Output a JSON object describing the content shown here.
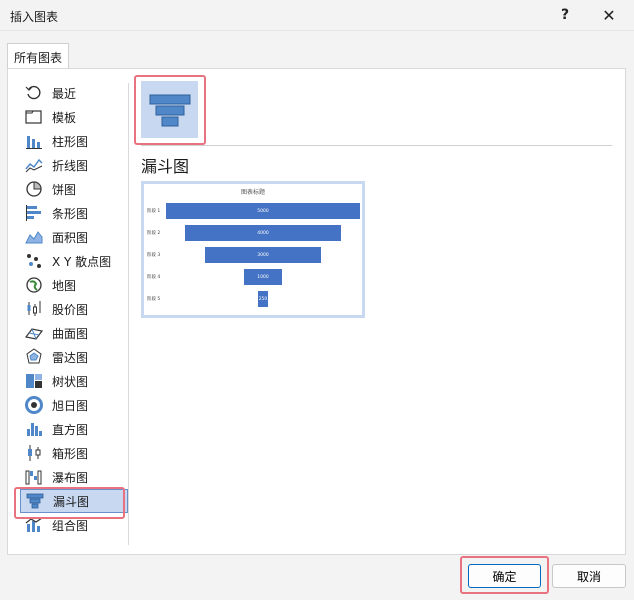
{
  "window": {
    "title": "插入图表"
  },
  "titlebar": {
    "help_label": "?",
    "close_label": "✕"
  },
  "tabs": [
    {
      "label": "所有图表"
    }
  ],
  "nav": {
    "items": [
      {
        "label": "最近",
        "icon": "recent-icon"
      },
      {
        "label": "模板",
        "icon": "template-folder-icon"
      },
      {
        "label": "柱形图",
        "icon": "column-chart-icon"
      },
      {
        "label": "折线图",
        "icon": "line-chart-icon"
      },
      {
        "label": "饼图",
        "icon": "pie-chart-icon"
      },
      {
        "label": "条形图",
        "icon": "bar-chart-icon"
      },
      {
        "label": "面积图",
        "icon": "area-chart-icon"
      },
      {
        "label": "X Y 散点图",
        "icon": "scatter-chart-icon"
      },
      {
        "label": "地图",
        "icon": "map-chart-icon"
      },
      {
        "label": "股价图",
        "icon": "stock-chart-icon"
      },
      {
        "label": "曲面图",
        "icon": "surface-chart-icon"
      },
      {
        "label": "雷达图",
        "icon": "radar-chart-icon"
      },
      {
        "label": "树状图",
        "icon": "treemap-chart-icon"
      },
      {
        "label": "旭日图",
        "icon": "sunburst-chart-icon"
      },
      {
        "label": "直方图",
        "icon": "histogram-chart-icon"
      },
      {
        "label": "箱形图",
        "icon": "box-whisker-chart-icon"
      },
      {
        "label": "瀑布图",
        "icon": "waterfall-chart-icon"
      },
      {
        "label": "漏斗图",
        "icon": "funnel-chart-icon",
        "selected": true
      },
      {
        "label": "组合图",
        "icon": "combo-chart-icon"
      }
    ]
  },
  "main": {
    "chart_type_title": "漏斗图",
    "preview": {
      "title": "图表标题",
      "rows": [
        {
          "label": "阶段 1",
          "value": "5000",
          "fraction": 1.0
        },
        {
          "label": "阶段 2",
          "value": "4000",
          "fraction": 0.8
        },
        {
          "label": "阶段 3",
          "value": "3000",
          "fraction": 0.6
        },
        {
          "label": "阶段 4",
          "value": "1000",
          "fraction": 0.2
        },
        {
          "label": "阶段 5",
          "value": "250",
          "fraction": 0.05
        }
      ]
    }
  },
  "buttons": {
    "ok": "确定",
    "cancel": "取消"
  },
  "colors": {
    "accent": "#4472c4",
    "selection": "#c7d8f0",
    "highlight": "#e8727f"
  }
}
